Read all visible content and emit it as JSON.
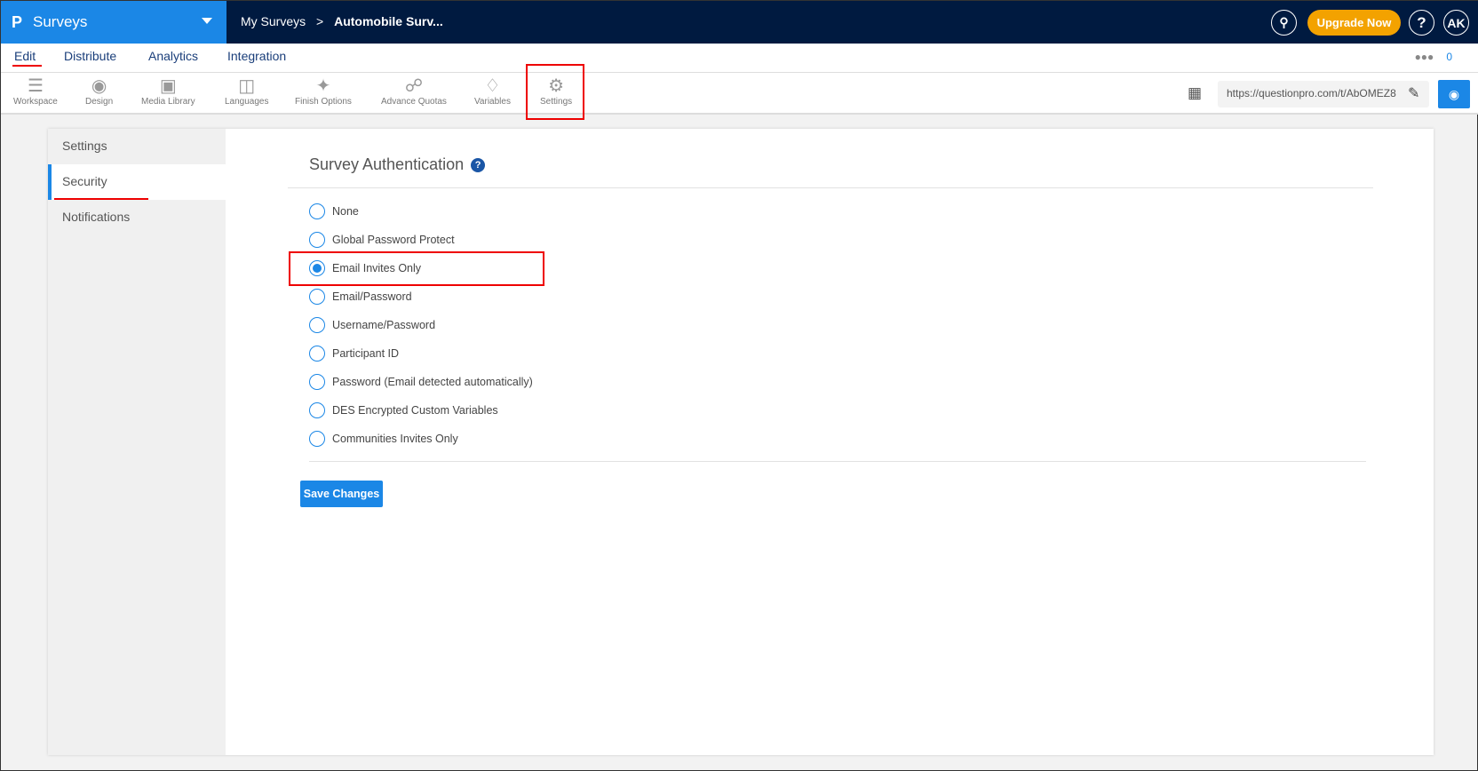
{
  "header": {
    "brand": "Surveys",
    "breadcrumb": [
      "My Surveys",
      ">",
      "Automobile Surv..."
    ],
    "upgrade": "Upgrade Now",
    "help": "?",
    "avatar": "AK"
  },
  "tabs": [
    "Edit",
    "Distribute",
    "Analytics",
    "Integration"
  ],
  "respondents": "0",
  "toolbar": [
    "Workspace",
    "Design",
    "Media Library",
    "Languages",
    "Finish Options",
    "Advance Quotas",
    "Variables",
    "Settings"
  ],
  "survey_url": "https://questionpro.com/t/AbOMEZ8",
  "sidebar": [
    "Settings",
    "Security",
    "Notifications"
  ],
  "section_title": "Survey Authentication",
  "options": [
    "None",
    "Global Password Protect",
    "Email Invites Only",
    "Email/Password",
    "Username/Password",
    "Participant ID",
    "Password (Email detected automatically)",
    "DES Encrypted Custom Variables",
    "Communities Invites Only"
  ],
  "selected_option": "Email Invites Only",
  "save_label": "Save Changes"
}
